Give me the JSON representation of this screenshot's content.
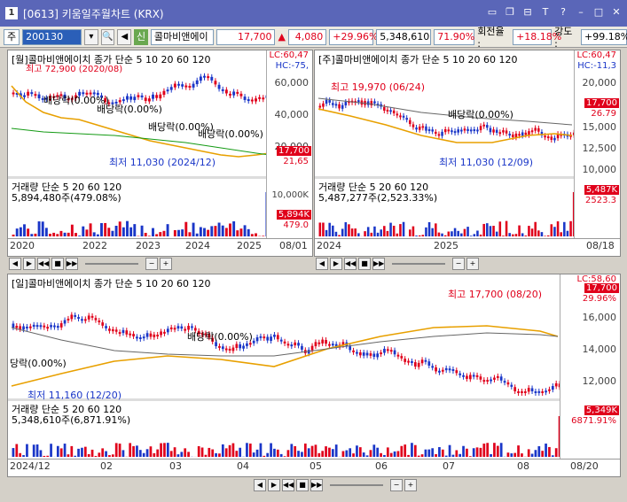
{
  "window": {
    "num": "1",
    "title": "[0613] 키움일주월차트 (KRX)",
    "icons": [
      "restore-icon",
      "copy-icon",
      "pin-icon",
      "text-icon",
      "help-icon",
      "minimize-icon",
      "maximize-icon",
      "close-icon"
    ]
  },
  "toolbar": {
    "period": "주",
    "code": "200130",
    "sin": "신",
    "name": "콜마비앤에이",
    "price": "17,700",
    "change": "4,080",
    "change_pct": "+29.96%",
    "volume": "5,348,610",
    "vol_pct": "71.90%",
    "turnover_label": "회전율 :",
    "turnover": "+18.18%",
    "strength_label": "강도 :",
    "strength": "+99.18%"
  },
  "panelA": {
    "header": "[월]콜마비앤에이치  종가 단순 5  10  20  60  120",
    "ma_label": "종가 단순",
    "high_label": "최고 72,900 (2020/08)",
    "low_label": "최저 11,030 (2024/12)",
    "div_labels": [
      "배당락(0.00%)",
      "배당락(0.00%)",
      "배당락(0.00%)",
      "배당락(0.00%)",
      "배당락(0.00%)"
    ],
    "lc": "LC:60,47",
    "hc": "HC:-75,",
    "yticks": [
      "60,000",
      "40,000",
      "20,000"
    ],
    "price_badge": "17,700",
    "pct_badge": "21,65",
    "vol_header": "거래량  단순 5  20  60  120",
    "vol_value": "5,894,480주(479.08%)",
    "vol_ticks": [
      "10,000K",
      "5,000K"
    ],
    "vol_badge": "5,894K",
    "vol_pct_badge": "479.0",
    "xlabels": [
      "2020",
      "2022",
      "2023",
      "2024",
      "2025"
    ],
    "x_end": "08/01"
  },
  "panelB": {
    "header": "[주]콜마비앤에이치  종가 단순 5  10  20  60  120",
    "high_label": "최고 19,970 (06/24)",
    "low_label": "최저 11,030 (12/09)",
    "div_label": "배당락(0.00%)",
    "lc": "LC:60,47",
    "hc": "HC:-11,3",
    "yticks": [
      "20,000",
      "17,500",
      "15,000",
      "12,500",
      "10,000"
    ],
    "price_badge": "17,700",
    "pct_badge": "26.79",
    "vol_header": "거래량  단순 5  20  60  120",
    "vol_value": "5,487,277주(2,523.33%)",
    "vol_badge": "5,487K",
    "vol_pct_badge": "2523.3",
    "xlabels": [
      "2024",
      "2025"
    ],
    "x_end": "08/18"
  },
  "panelC": {
    "header": "[일]콜마비앤에이치  종가 단순 5  10  20  60  120",
    "high_label": "최고 17,700 (08/20)",
    "low_label": "최저 11,160 (12/20)",
    "div_label1": "배당락(0.00%)",
    "div_label2": "당락(0.00%)",
    "lc": "LC:58,60",
    "yticks": [
      "16,000",
      "14,000",
      "12,000"
    ],
    "price_badge": "17,700",
    "pct_badge": "29.96%",
    "vol_header": "거래량  단순 5  20  60  120",
    "vol_value": "5,348,610주(6,871.91%)",
    "vol_badge": "5,349K",
    "vol_pct_badge": "6871.91%",
    "xlabels": [
      "2024/12",
      "02",
      "03",
      "04",
      "05",
      "06",
      "07",
      "08"
    ],
    "x_end": "08/20"
  },
  "colors": {
    "up": "#e0001b",
    "down": "#1a36c8",
    "ma5": "#e0001b",
    "ma10": "#1a36c8",
    "ma20": "#e8a000",
    "ma60": "#139a13",
    "ma120": "#666666"
  }
}
